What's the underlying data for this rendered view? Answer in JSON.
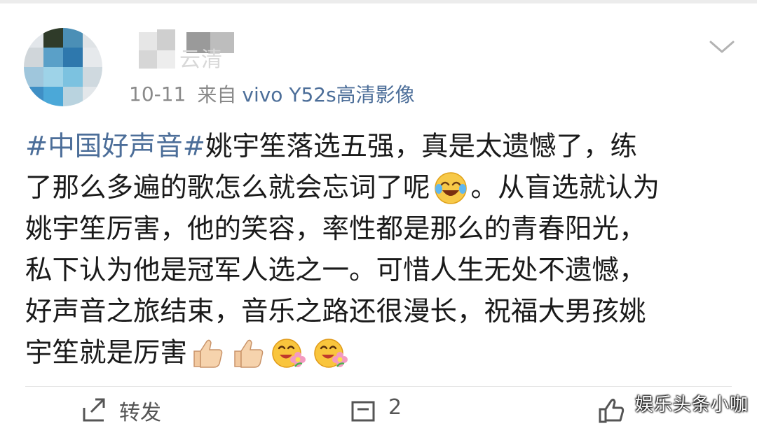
{
  "post": {
    "username": "云清",
    "time": "10-11",
    "source_prefix": "来自",
    "source": "vivo Y52s高清影像",
    "lines": [
      {
        "hashtag": "#中国好声音#",
        "text": " 姚宇笙落选五强，真是太遗憾了，练"
      },
      {
        "text": "了那么多遍的歌怎么就会忘词了呢",
        "emoji": "laugh-cry-emoji",
        "text_after": "。从盲选就认为"
      },
      {
        "text": "姚宇笙厉害，他的笑容，率性都是那么的青春阳光，"
      },
      {
        "text": "私下认为他是冠军人选之一。可惜人生无处不遗憾，"
      },
      {
        "text": "好声音之旅结束，音乐之路还很漫长，祝福大男孩姚"
      },
      {
        "text": "宇笙就是厉害",
        "emojis": [
          "thumbs-up-emoji",
          "thumbs-up-emoji",
          "flower-face-emoji",
          "flower-face-emoji"
        ]
      }
    ]
  },
  "actions": {
    "repost_label": "转发",
    "comment_count": "2",
    "like_count": ""
  },
  "watermark": "娱乐头条小咖",
  "icons": {
    "more": "chevron-down-icon",
    "repost": "repost-icon",
    "comment": "comment-icon",
    "like": "like-icon"
  },
  "colors": {
    "link": "#4c6e99",
    "meta": "#8a8a8a",
    "text": "#1a1a1a"
  }
}
